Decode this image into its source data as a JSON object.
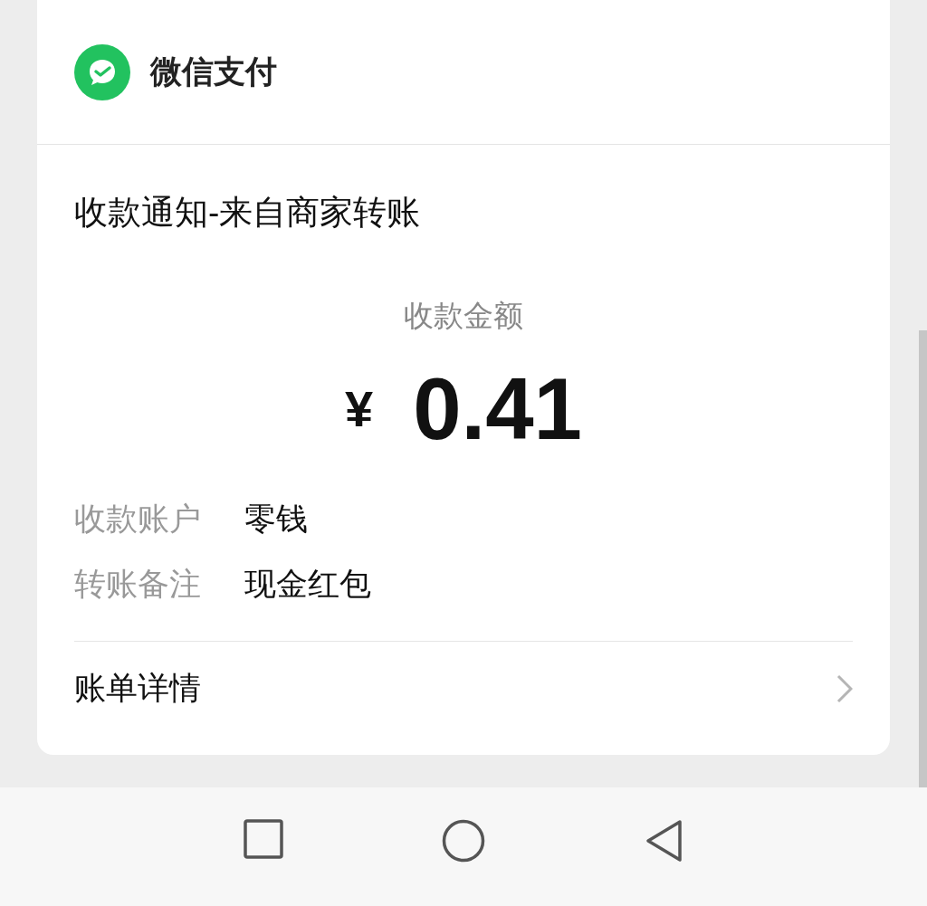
{
  "header": {
    "title": "微信支付"
  },
  "notice": {
    "title": "收款通知-来自商家转账",
    "amount_label": "收款金额",
    "currency": "¥",
    "amount": "0.41"
  },
  "details": [
    {
      "label": "收款账户",
      "value": "零钱"
    },
    {
      "label": "转账备注",
      "value": "现金红包"
    }
  ],
  "link": {
    "label": "账单详情"
  }
}
